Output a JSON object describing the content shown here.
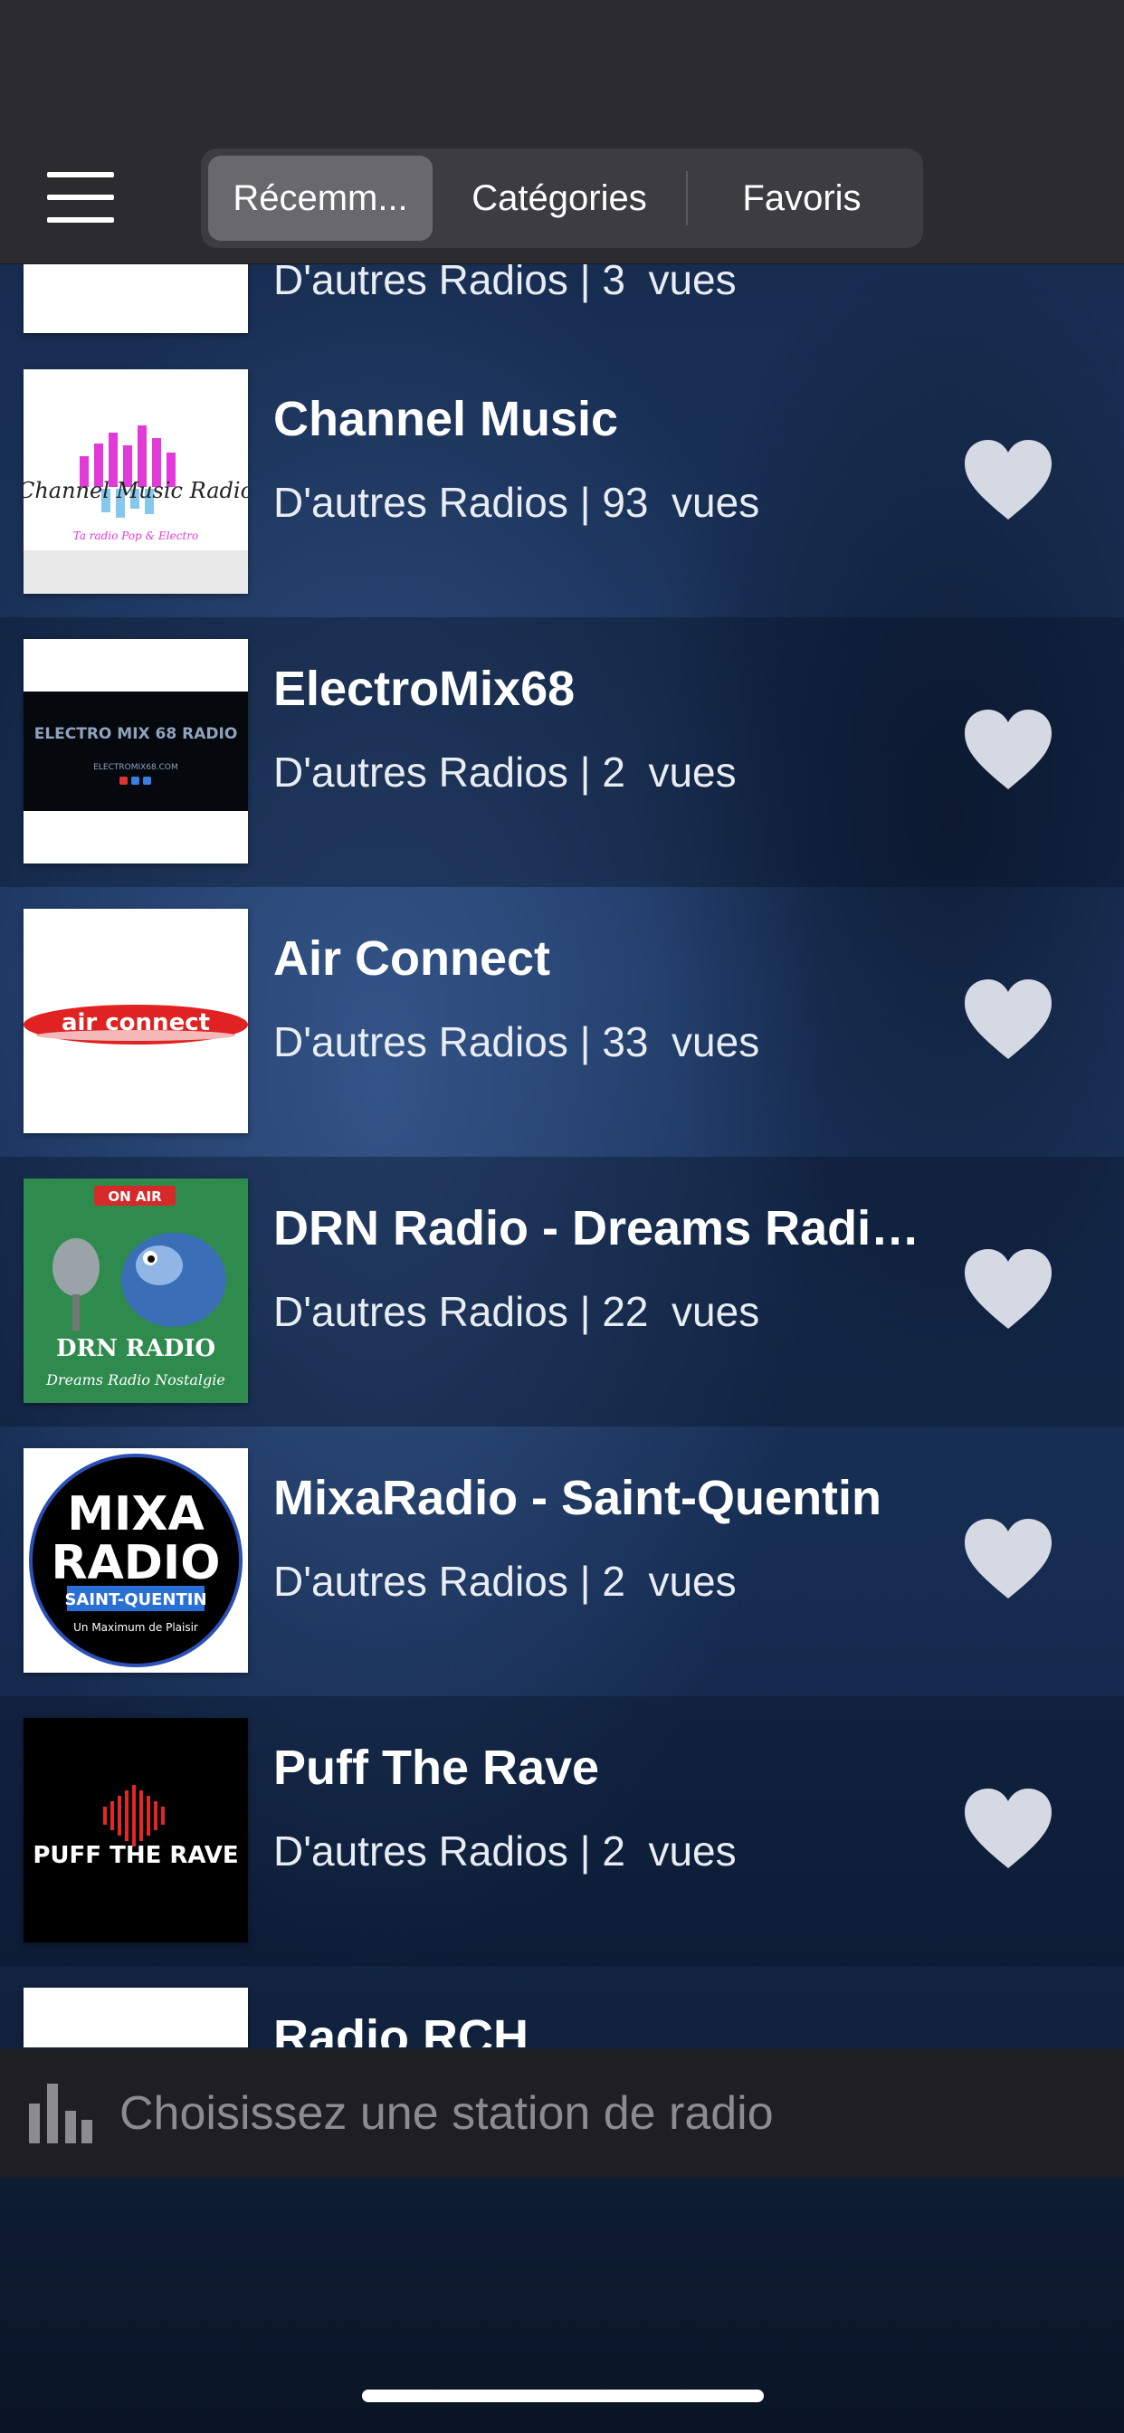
{
  "tabs": [
    {
      "label": "Récemm...",
      "active": true
    },
    {
      "label": "Catégories",
      "active": false
    },
    {
      "label": "Favoris",
      "active": false
    }
  ],
  "stations": [
    {
      "name": "",
      "meta": "D'autres Radios | 3  vues",
      "logo": "partial-logo",
      "favorite": false
    },
    {
      "name": "Channel Music",
      "meta": "D'autres Radios | 93  vues",
      "logo": "channel-music-logo",
      "logo_text": "Channel Music Radio",
      "logo_tagline": "Ta radio Pop & Electro",
      "favorite": false
    },
    {
      "name": "ElectroMix68",
      "meta": "D'autres Radios | 2  vues",
      "logo": "electromix68-logo",
      "logo_text": "ELECTRO MIX 68 RADIO",
      "logo_url": "ELECTROMIX68.COM",
      "favorite": false
    },
    {
      "name": "Air Connect",
      "meta": "D'autres Radios | 33  vues",
      "logo": "air-connect-logo",
      "logo_text": "air connect",
      "favorite": false
    },
    {
      "name": "DRN Radio - Dreams Radio Nostalgie",
      "meta": "D'autres Radios | 22  vues",
      "logo": "drn-radio-logo",
      "logo_badge": "ON AIR",
      "logo_text": "DRN RADIO",
      "logo_tagline": "Dreams Radio Nostalgie",
      "favorite": false
    },
    {
      "name": "MixaRadio - Saint-Quentin",
      "meta": "D'autres Radios | 2  vues",
      "logo": "mixaradio-logo",
      "logo_line1": "MIXA",
      "logo_line2": "RADIO",
      "logo_city": "SAINT-QUENTIN",
      "logo_tagline": "Un Maximum de Plaisir",
      "favorite": false
    },
    {
      "name": "Puff The Rave",
      "meta": "D'autres Radios | 2  vues",
      "logo": "puff-the-rave-logo",
      "logo_text": "PUFF THE RAVE",
      "favorite": false
    },
    {
      "name": "Radio RCH",
      "meta": "",
      "logo": "partial-logo",
      "favorite": false
    }
  ],
  "player": {
    "placeholder": "Choisissez une station de radio",
    "icon": "equalizer-icon"
  },
  "colors": {
    "header": "#2c2c2e",
    "player_bar": "#1f1f21",
    "heart": "#d5d9e3",
    "active_tab": "#68686d"
  }
}
